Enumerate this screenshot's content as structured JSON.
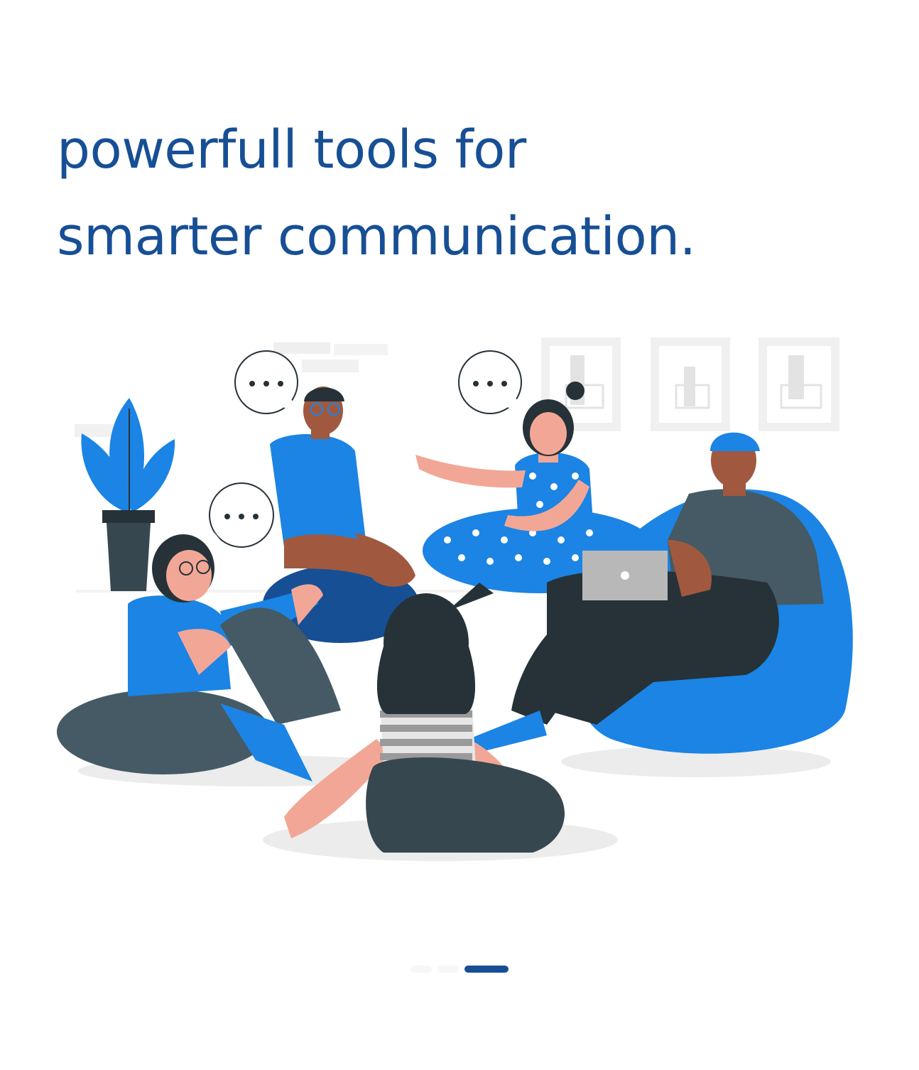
{
  "onboarding": {
    "headline_line1": "powerfull tools for",
    "headline_line2": "smarter communication.",
    "illustration": {
      "icon": "group-discussion-illustration",
      "speech_bubble_text": "..."
    },
    "pager": {
      "pages": 3,
      "active_index": 2
    }
  },
  "colors": {
    "headline": "#174f95",
    "accent_blue": "#1b84e4",
    "dark": "#263238",
    "grey": "#455a64",
    "skin_light": "#f2a796",
    "skin_dark": "#a0593f"
  }
}
